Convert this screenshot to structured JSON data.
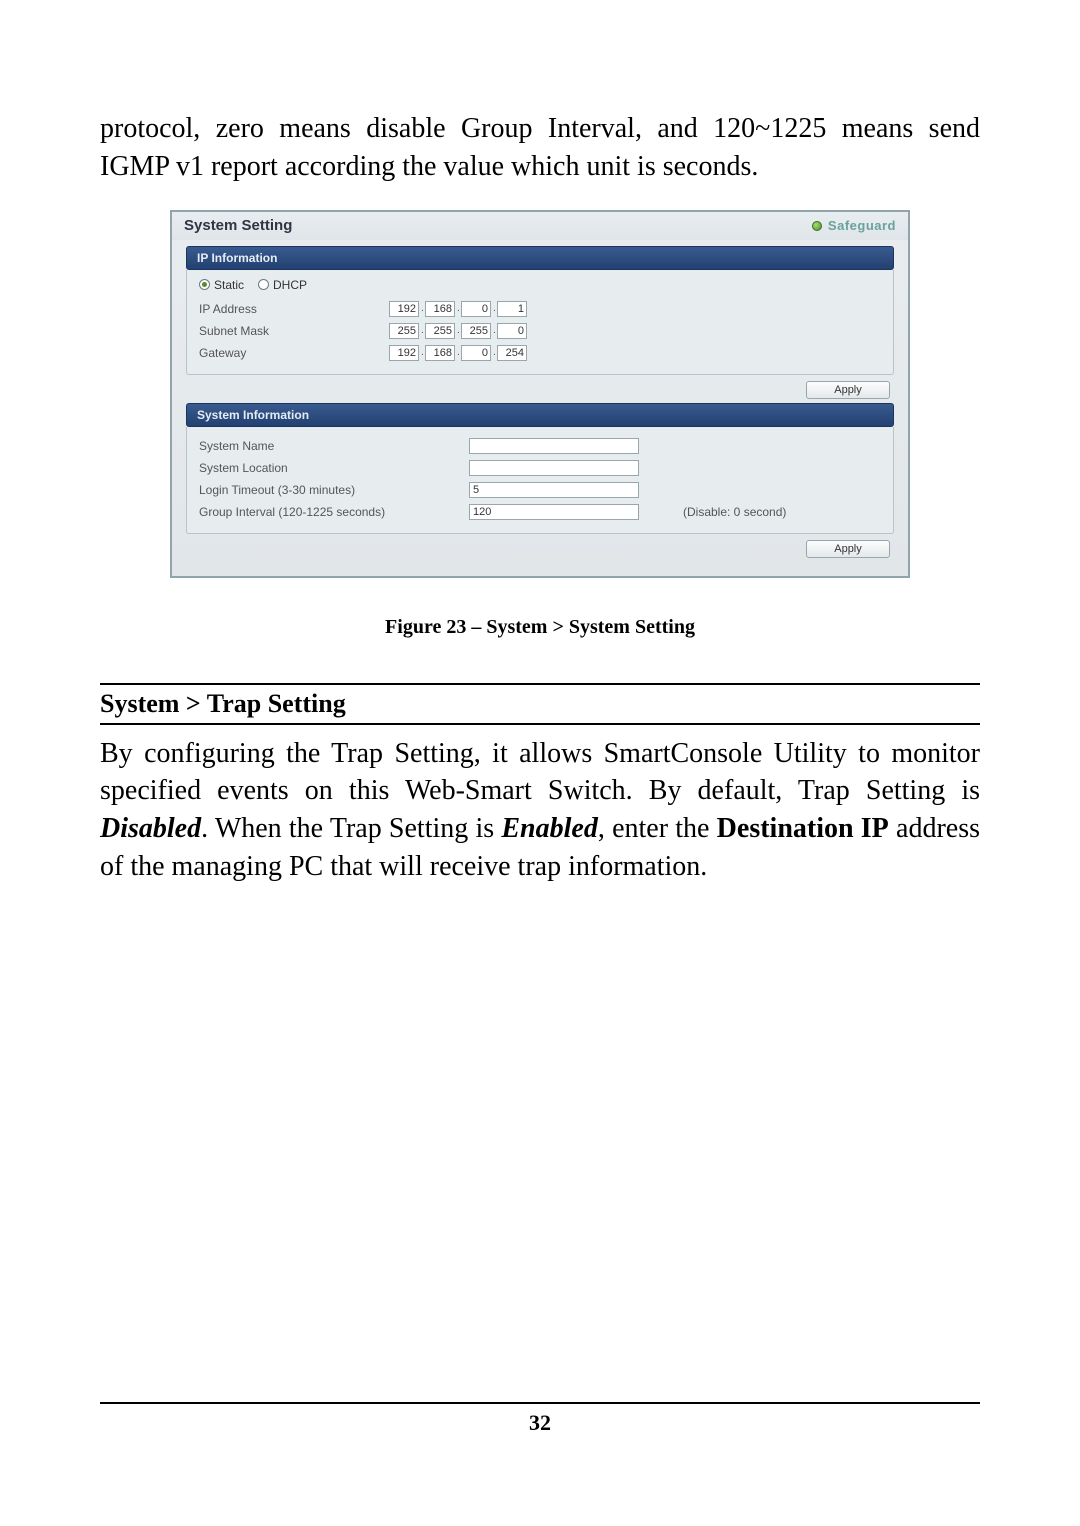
{
  "top_para_fragment_1": "protocol, zero means disable Group Interval, and 120~1225 means send IGMP v1 report according the value which unit is seconds.",
  "screenshot": {
    "title": "System Setting",
    "safeguard": "Safeguard",
    "ip_info_header": "IP Information",
    "radio_static": "Static",
    "radio_dhcp": "DHCP",
    "labels": {
      "ip_address": "IP Address",
      "subnet_mask": "Subnet Mask",
      "gateway": "Gateway"
    },
    "ip_address": {
      "o1": "192",
      "o2": "168",
      "o3": "0",
      "o4": "1"
    },
    "subnet_mask": {
      "o1": "255",
      "o2": "255",
      "o3": "255",
      "o4": "0"
    },
    "gateway": {
      "o1": "192",
      "o2": "168",
      "o3": "0",
      "o4": "254"
    },
    "apply": "Apply",
    "sysinfo_header": "System Information",
    "sysinfo_labels": {
      "name": "System Name",
      "location": "System Location",
      "login_timeout": "Login Timeout (3-30 minutes)",
      "group_interval": "Group Interval (120-1225 seconds)"
    },
    "sysinfo_values": {
      "name": "",
      "location": "",
      "login_timeout": "5",
      "group_interval": "120"
    },
    "group_interval_note": "(Disable: 0 second)"
  },
  "figure_caption": "Figure 23 – System > System Setting",
  "section_heading": "System > Trap Setting",
  "body_para_pre": "By configuring the Trap Setting, it allows SmartConsole Utility to monitor specified events on this Web-Smart Switch. By default, Trap Setting is ",
  "body_para_disabled": "Disabled",
  "body_para_mid1": ". When the Trap Setting is ",
  "body_para_enabled": "Enabled",
  "body_para_mid2": ", enter the ",
  "body_para_destip": "Destination IP",
  "body_para_post": " address of the managing PC that will receive trap information.",
  "page_number": "32"
}
